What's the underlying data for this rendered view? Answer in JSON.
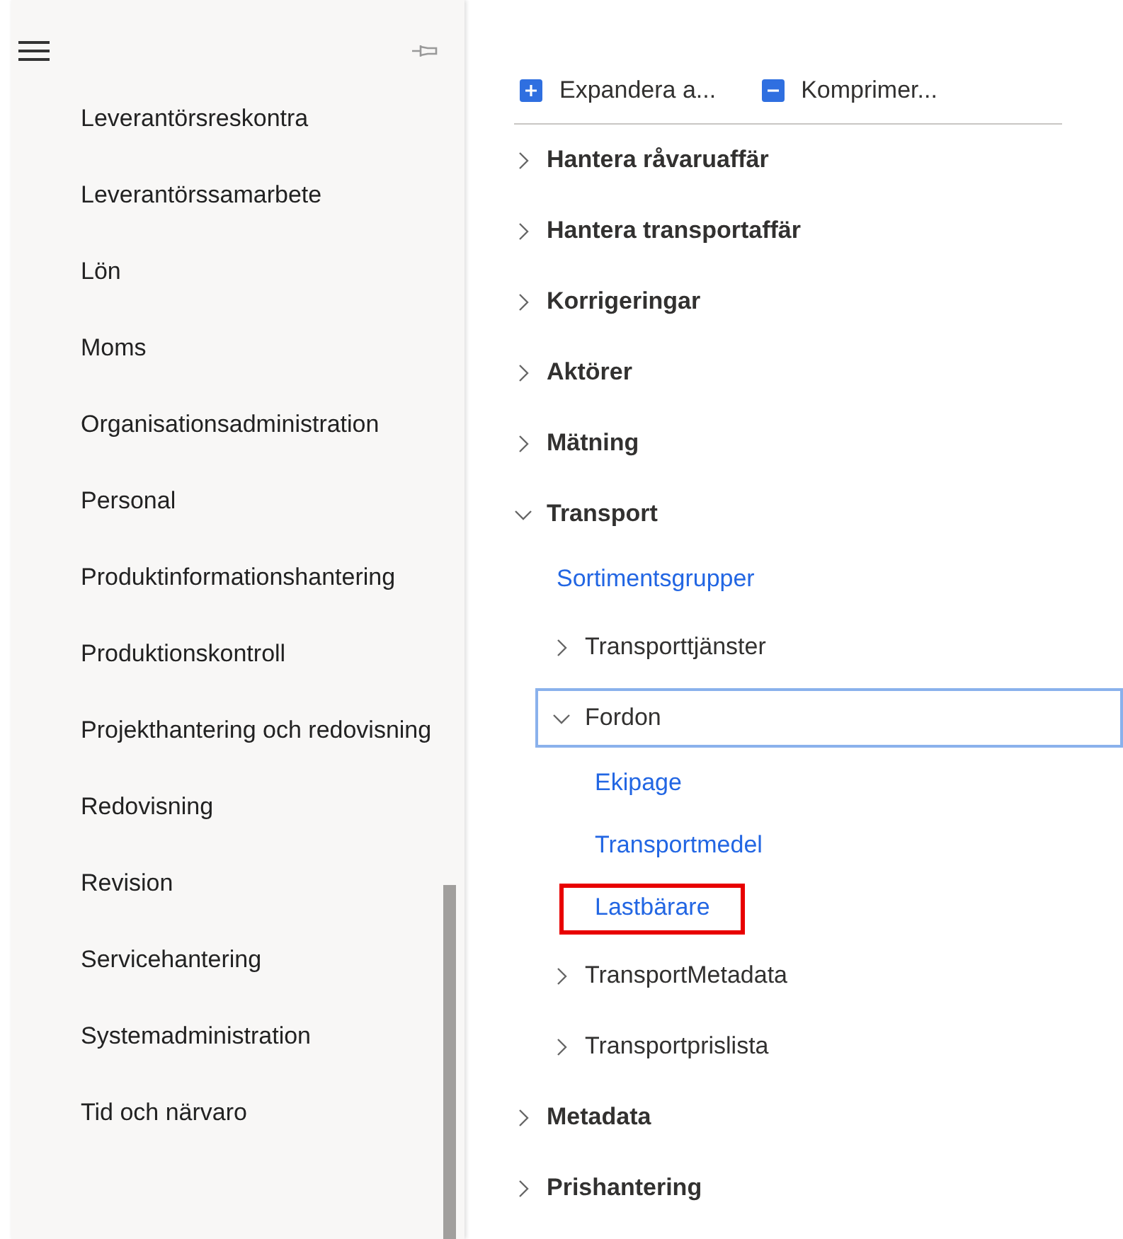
{
  "sidebar": {
    "items": [
      {
        "label": "Leverantörsreskontra"
      },
      {
        "label": "Leverantörssamarbete"
      },
      {
        "label": "Lön"
      },
      {
        "label": "Moms"
      },
      {
        "label": "Organisationsadministration"
      },
      {
        "label": "Personal"
      },
      {
        "label": "Produktinformationshantering"
      },
      {
        "label": "Produktionskontroll"
      },
      {
        "label": "Projekthantering och redovisning"
      },
      {
        "label": "Redovisning"
      },
      {
        "label": "Revision"
      },
      {
        "label": "Servicehantering"
      },
      {
        "label": "Systemadministration"
      },
      {
        "label": "Tid och närvaro"
      }
    ]
  },
  "toolbar": {
    "buttons": [
      {
        "kind": "expand",
        "label": "Expandera a..."
      },
      {
        "kind": "collapse",
        "label": "Komprimer..."
      }
    ]
  },
  "tree": {
    "items": [
      {
        "kind": "group",
        "label": "Hantera råvaruaffär",
        "expanded": false,
        "focused": false
      },
      {
        "kind": "group",
        "label": "Hantera transportaffär",
        "expanded": false,
        "focused": false
      },
      {
        "kind": "group",
        "label": "Korrigeringar",
        "expanded": false,
        "focused": false
      },
      {
        "kind": "group",
        "label": "Aktörer",
        "expanded": false,
        "focused": false
      },
      {
        "kind": "group",
        "label": "Mätning",
        "expanded": false,
        "focused": false
      },
      {
        "kind": "group",
        "label": "Transport",
        "expanded": true,
        "focused": false,
        "children": [
          {
            "kind": "link",
            "label": "Sortimentsgrupper",
            "highlighted": false
          },
          {
            "kind": "group",
            "label": "Transporttjänster",
            "expanded": false,
            "focused": false
          },
          {
            "kind": "group",
            "label": "Fordon",
            "expanded": true,
            "focused": true,
            "children": [
              {
                "kind": "link",
                "label": "Ekipage",
                "highlighted": false
              },
              {
                "kind": "link",
                "label": "Transportmedel",
                "highlighted": false
              },
              {
                "kind": "link",
                "label": "Lastbärare",
                "highlighted": true
              }
            ]
          },
          {
            "kind": "group",
            "label": "TransportMetadata",
            "expanded": false,
            "focused": false
          },
          {
            "kind": "group",
            "label": "Transportprislista",
            "expanded": false,
            "focused": false
          }
        ]
      },
      {
        "kind": "group",
        "label": "Metadata",
        "expanded": false,
        "focused": false
      },
      {
        "kind": "group",
        "label": "Prishantering",
        "expanded": false,
        "focused": false
      }
    ]
  }
}
